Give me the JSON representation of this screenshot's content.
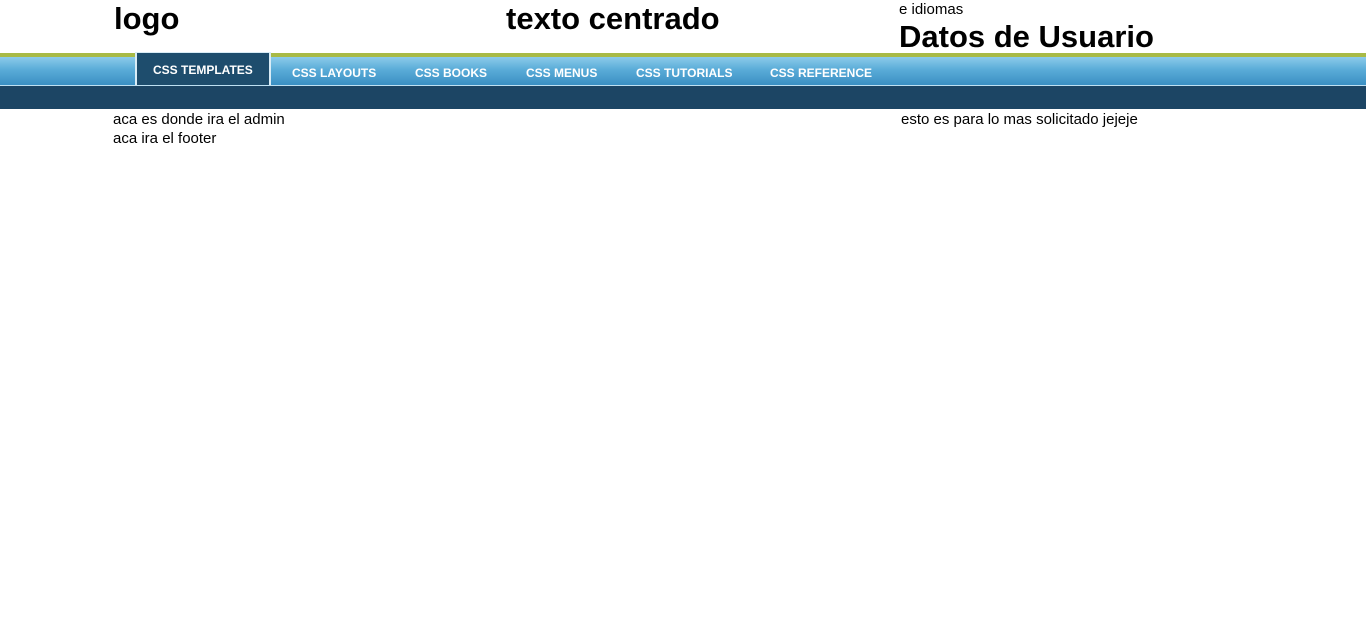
{
  "header": {
    "logo": "logo",
    "center_text": "texto centrado",
    "languages": "e idiomas",
    "user_data": "Datos de Usuario"
  },
  "nav": {
    "items": [
      {
        "label": "CSS TEMPLATES",
        "active": true
      },
      {
        "label": "CSS LAYOUTS",
        "active": false
      },
      {
        "label": "CSS BOOKS",
        "active": false
      },
      {
        "label": "CSS MENUS",
        "active": false
      },
      {
        "label": "CSS TUTORIALS",
        "active": false
      },
      {
        "label": "CSS REFERENCE",
        "active": false
      }
    ]
  },
  "content": {
    "admin": "aca es donde ira el admin",
    "footer": "aca ira el footer",
    "most_requested": "esto es para lo mas solicitado jejeje"
  },
  "colors": {
    "accent_line": "#a8ba46",
    "nav_active": "#1e4d6d",
    "dark_bar": "#1c4564"
  }
}
